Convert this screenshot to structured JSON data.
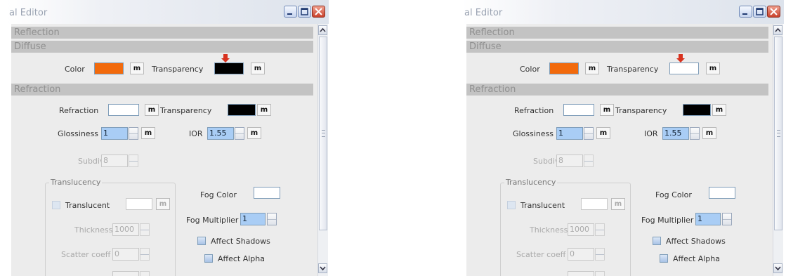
{
  "window_title": "al Editor",
  "sections": {
    "reflection": "Reflection",
    "diffuse": "Diffuse",
    "refraction": "Refraction"
  },
  "diffuse": {
    "color_label": "Color",
    "color_value": "#f26a0c",
    "map_button": "m",
    "transparency_label": "Transparency"
  },
  "refraction": {
    "refraction_label": "Refraction",
    "refraction_color": "#ffffff",
    "transparency_label": "Transparency",
    "transparency_color": "#000000",
    "glossiness_label": "Glossiness",
    "glossiness_value": "1",
    "ior_label": "IOR",
    "ior_value": "1.55",
    "subdivs_label": "Subdivs",
    "subdivs_value": "8",
    "fog_color_label": "Fog Color",
    "fog_color": "#ffffff",
    "fog_multiplier_label": "Fog Multiplier",
    "fog_multiplier_value": "1",
    "affect_shadows_label": "Affect Shadows",
    "affect_alpha_label": "Affect Alpha"
  },
  "translucency": {
    "group_title": "Translucency",
    "translucent_label": "Translucent",
    "thickness_label": "Thickness",
    "thickness_value": "1000",
    "scatter_label": "Scatter coeff",
    "scatter_value": "0"
  },
  "panels": [
    {
      "name": "left",
      "diffuse_transparency_color": "#000000"
    },
    {
      "name": "right",
      "diffuse_transparency_color": "#ffffff"
    }
  ],
  "accent_arrow_color": "#d8321f"
}
